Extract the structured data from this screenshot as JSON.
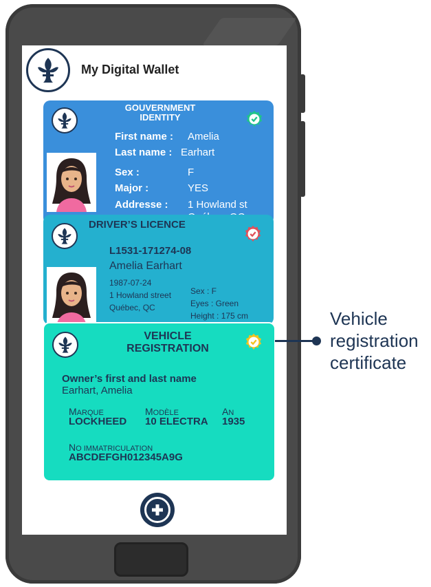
{
  "app": {
    "title": "My Digital Wallet"
  },
  "cards": {
    "identity": {
      "title_line1": "GOUVERNMENT",
      "title_line2": "IDENTITY",
      "first_name_label": "First name :",
      "first_name": "Amelia",
      "last_name_label": "Last name :",
      "last_name": "Earhart",
      "sex_label": "Sex :",
      "sex": "F",
      "major_label": "Major :",
      "major": "YES",
      "address_label": "Addresse :",
      "address": "1 Howland st",
      "address2": "Québec, QC",
      "badge_color": "#21c48a"
    },
    "licence": {
      "title": "DRIVER’S LICENCE",
      "number": "L1531-171274-08",
      "name": "Amelia Earhart",
      "dob": "1987-07-24",
      "street": "1 Howland street",
      "city": "Québec, QC",
      "sex": "Sex : F",
      "eyes": "Eyes : Green",
      "height": "Height : 175 cm",
      "badge_color": "#e0505a"
    },
    "vehicle": {
      "title_line1": "VEHICLE",
      "title_line2": "REGISTRATION",
      "owner_label": "Owner’s first and last name",
      "owner": "Earhart, Amelia",
      "make_label_first": "M",
      "make_label_rest": "ARQUE",
      "make": "LOCKHEED",
      "model_label_first": "M",
      "model_label_rest": "ODÈLE",
      "model": "10 ELECTRA",
      "year_label_first": "A",
      "year_label_rest": "N",
      "year": "1935",
      "plate_label_first": "N",
      "plate_label_rest": "O I",
      "plate_label_first2": "",
      "plate_label_rest2": "MMATRICULATION",
      "plate": "ABCDEFGH012345A9G",
      "badge_color": "#f2c31f"
    }
  },
  "callout": {
    "line1": "Vehicle",
    "line2": "registration",
    "line3": "certificate"
  },
  "colors": {
    "navy": "#1e3554",
    "card_blue": "#3a8fdb",
    "card_teal": "#24b0cf",
    "card_green": "#16dcc0"
  },
  "icons": {
    "logo": "fleur-de-lis-icon",
    "add": "plus-icon",
    "verified": "check-badge-icon"
  }
}
